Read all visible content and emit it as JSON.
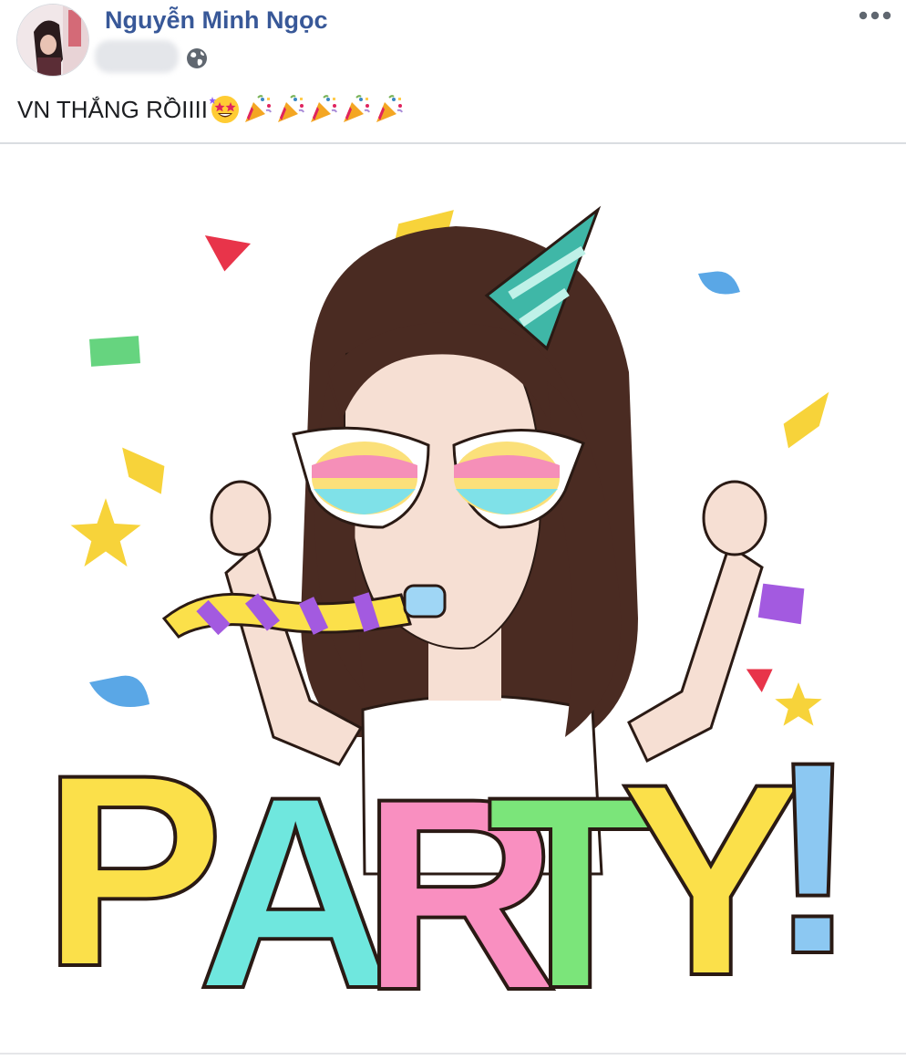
{
  "post": {
    "author": {
      "name": "Nguyễn Minh Ngọc",
      "avatar_icon": "profile-photo"
    },
    "timestamp_blurred": true,
    "privacy_icon": "globe-icon",
    "menu_icon": "more-dots-icon",
    "text": "VN THẮNG RỒIIII",
    "emojis": [
      "star-struck-emoji",
      "party-popper-emoji",
      "party-popper-emoji",
      "party-popper-emoji",
      "party-popper-emoji",
      "party-popper-emoji"
    ],
    "image": {
      "caption_text": "PARTY!",
      "letters": [
        "P",
        "A",
        "R",
        "T",
        "Y",
        "!"
      ]
    }
  },
  "colors": {
    "author_link": "#385898",
    "text": "#1c1e21",
    "divider": "#dadde1",
    "letter_yellow": "#fbe04a",
    "letter_cyan": "#6fe7de",
    "letter_pink": "#f98fc0",
    "letter_green": "#7be57a",
    "letter_blue": "#8cc8f2"
  }
}
